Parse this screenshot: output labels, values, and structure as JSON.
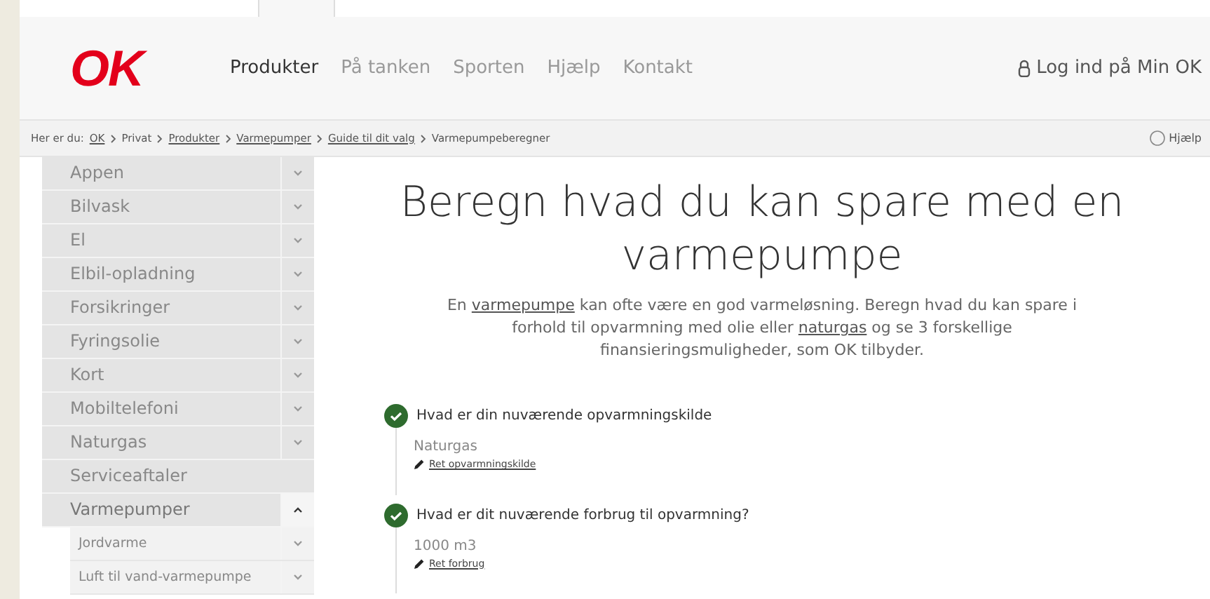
{
  "header": {
    "logo": "OK",
    "nav": [
      {
        "label": "Produkter",
        "selected": true
      },
      {
        "label": "På tanken",
        "selected": false
      },
      {
        "label": "Sporten",
        "selected": false
      },
      {
        "label": "Hjælp",
        "selected": false
      },
      {
        "label": "Kontakt",
        "selected": false
      }
    ],
    "login": "Log ind på Min OK"
  },
  "breadcrumb": {
    "prefix": "Her er du:",
    "items": [
      {
        "label": "OK",
        "link": true
      },
      {
        "label": "Privat",
        "link": false
      },
      {
        "label": "Produkter",
        "link": true
      },
      {
        "label": "Varmepumper",
        "link": true
      },
      {
        "label": "Guide til dit valg",
        "link": true
      },
      {
        "label": "Varmepumpeberegner",
        "link": false
      }
    ],
    "help": "Hjælp"
  },
  "sidebar": {
    "items": [
      {
        "label": "Appen",
        "expandable": true,
        "expanded": false
      },
      {
        "label": "Bilvask",
        "expandable": true,
        "expanded": false
      },
      {
        "label": "El",
        "expandable": true,
        "expanded": false
      },
      {
        "label": "Elbil-opladning",
        "expandable": true,
        "expanded": false
      },
      {
        "label": "Forsikringer",
        "expandable": true,
        "expanded": false
      },
      {
        "label": "Fyringsolie",
        "expandable": true,
        "expanded": false
      },
      {
        "label": "Kort",
        "expandable": true,
        "expanded": false
      },
      {
        "label": "Mobiltelefoni",
        "expandable": true,
        "expanded": false
      },
      {
        "label": "Naturgas",
        "expandable": true,
        "expanded": false
      },
      {
        "label": "Serviceaftaler",
        "expandable": false,
        "expanded": false
      },
      {
        "label": "Varmepumper",
        "expandable": true,
        "expanded": true,
        "children": [
          {
            "label": "Jordvarme",
            "expandable": true,
            "expanded": false
          },
          {
            "label": "Luft til vand-varmepumpe",
            "expandable": true,
            "expanded": false
          }
        ]
      }
    ]
  },
  "main": {
    "title": "Beregn hvad du kan spare med en varmepumpe",
    "intro": [
      {
        "kind": "text",
        "text": "En "
      },
      {
        "kind": "link",
        "text": "varmepumpe"
      },
      {
        "kind": "text",
        "text": " kan ofte være en god varmeløsning. Beregn hvad du kan spare i forhold til opvarmning med olie eller "
      },
      {
        "kind": "link",
        "text": "naturgas"
      },
      {
        "kind": "text",
        "text": " og se 3 forskellige finansieringsmuligheder, som OK tilbyder."
      }
    ],
    "steps": [
      {
        "question": "Hvad er din nuværende opvarmningskilde",
        "done": true,
        "answer": "Naturgas",
        "edit": "Ret opvarmningskilde"
      },
      {
        "question": "Hvad er dit nuværende forbrug til opvarmning?",
        "done": true,
        "answer": "1000 m3",
        "edit": "Ret forbrug"
      }
    ]
  }
}
